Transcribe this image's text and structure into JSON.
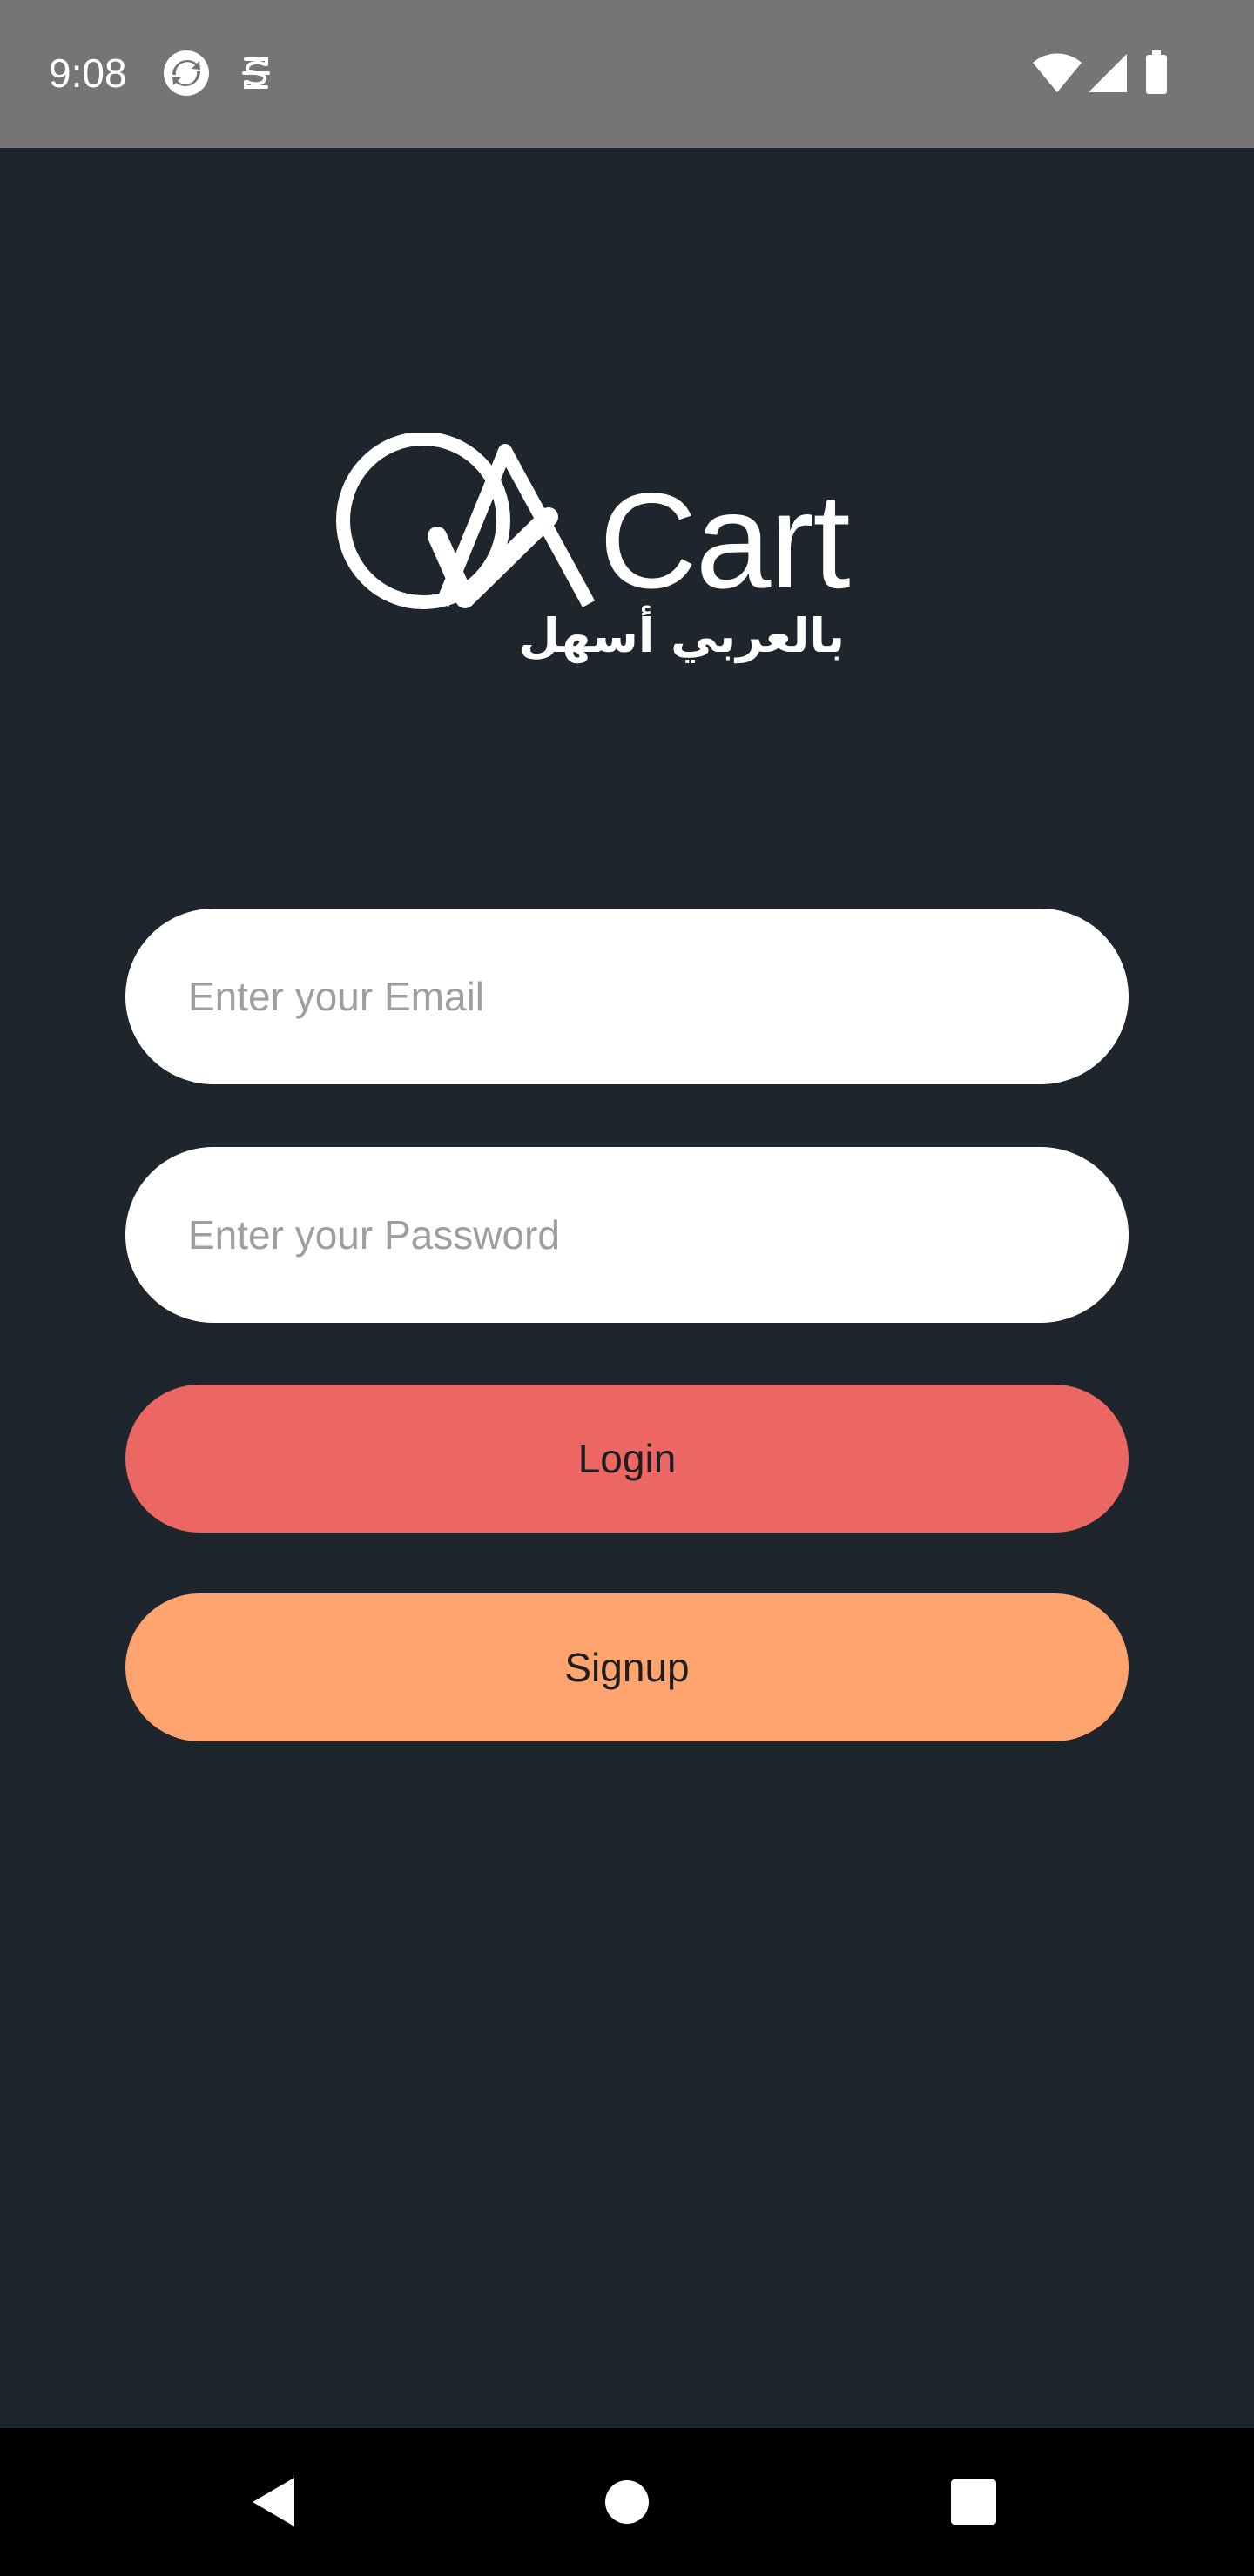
{
  "status_bar": {
    "time": "9:08",
    "icons": [
      "sync-icon",
      "s-notification-icon",
      "wifi-icon",
      "signal-icon",
      "battery-icon"
    ]
  },
  "logo": {
    "wordmark": "QACart",
    "tagline": "بالعربي أسهل"
  },
  "form": {
    "email_placeholder": "Enter your Email",
    "password_placeholder": "Enter your Password",
    "login_label": "Login",
    "signup_label": "Signup"
  },
  "colors": {
    "background": "#1E252C",
    "status_bar": "#757575",
    "login": "#EC6664",
    "signup": "#FFA36F",
    "field": "#FFFFFF"
  },
  "nav_bar": {
    "icons": [
      "back-icon",
      "home-icon",
      "recents-icon"
    ]
  }
}
